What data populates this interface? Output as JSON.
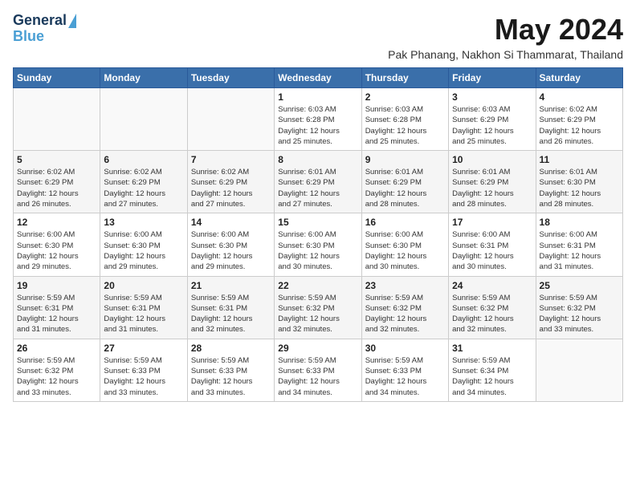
{
  "logo": {
    "line1": "General",
    "line2": "Blue"
  },
  "title": "May 2024",
  "subtitle": "Pak Phanang, Nakhon Si Thammarat, Thailand",
  "days_header": [
    "Sunday",
    "Monday",
    "Tuesday",
    "Wednesday",
    "Thursday",
    "Friday",
    "Saturday"
  ],
  "weeks": [
    [
      {
        "day": "",
        "info": ""
      },
      {
        "day": "",
        "info": ""
      },
      {
        "day": "",
        "info": ""
      },
      {
        "day": "1",
        "info": "Sunrise: 6:03 AM\nSunset: 6:28 PM\nDaylight: 12 hours\nand 25 minutes."
      },
      {
        "day": "2",
        "info": "Sunrise: 6:03 AM\nSunset: 6:28 PM\nDaylight: 12 hours\nand 25 minutes."
      },
      {
        "day": "3",
        "info": "Sunrise: 6:03 AM\nSunset: 6:29 PM\nDaylight: 12 hours\nand 25 minutes."
      },
      {
        "day": "4",
        "info": "Sunrise: 6:02 AM\nSunset: 6:29 PM\nDaylight: 12 hours\nand 26 minutes."
      }
    ],
    [
      {
        "day": "5",
        "info": "Sunrise: 6:02 AM\nSunset: 6:29 PM\nDaylight: 12 hours\nand 26 minutes."
      },
      {
        "day": "6",
        "info": "Sunrise: 6:02 AM\nSunset: 6:29 PM\nDaylight: 12 hours\nand 27 minutes."
      },
      {
        "day": "7",
        "info": "Sunrise: 6:02 AM\nSunset: 6:29 PM\nDaylight: 12 hours\nand 27 minutes."
      },
      {
        "day": "8",
        "info": "Sunrise: 6:01 AM\nSunset: 6:29 PM\nDaylight: 12 hours\nand 27 minutes."
      },
      {
        "day": "9",
        "info": "Sunrise: 6:01 AM\nSunset: 6:29 PM\nDaylight: 12 hours\nand 28 minutes."
      },
      {
        "day": "10",
        "info": "Sunrise: 6:01 AM\nSunset: 6:29 PM\nDaylight: 12 hours\nand 28 minutes."
      },
      {
        "day": "11",
        "info": "Sunrise: 6:01 AM\nSunset: 6:30 PM\nDaylight: 12 hours\nand 28 minutes."
      }
    ],
    [
      {
        "day": "12",
        "info": "Sunrise: 6:00 AM\nSunset: 6:30 PM\nDaylight: 12 hours\nand 29 minutes."
      },
      {
        "day": "13",
        "info": "Sunrise: 6:00 AM\nSunset: 6:30 PM\nDaylight: 12 hours\nand 29 minutes."
      },
      {
        "day": "14",
        "info": "Sunrise: 6:00 AM\nSunset: 6:30 PM\nDaylight: 12 hours\nand 29 minutes."
      },
      {
        "day": "15",
        "info": "Sunrise: 6:00 AM\nSunset: 6:30 PM\nDaylight: 12 hours\nand 30 minutes."
      },
      {
        "day": "16",
        "info": "Sunrise: 6:00 AM\nSunset: 6:30 PM\nDaylight: 12 hours\nand 30 minutes."
      },
      {
        "day": "17",
        "info": "Sunrise: 6:00 AM\nSunset: 6:31 PM\nDaylight: 12 hours\nand 30 minutes."
      },
      {
        "day": "18",
        "info": "Sunrise: 6:00 AM\nSunset: 6:31 PM\nDaylight: 12 hours\nand 31 minutes."
      }
    ],
    [
      {
        "day": "19",
        "info": "Sunrise: 5:59 AM\nSunset: 6:31 PM\nDaylight: 12 hours\nand 31 minutes."
      },
      {
        "day": "20",
        "info": "Sunrise: 5:59 AM\nSunset: 6:31 PM\nDaylight: 12 hours\nand 31 minutes."
      },
      {
        "day": "21",
        "info": "Sunrise: 5:59 AM\nSunset: 6:31 PM\nDaylight: 12 hours\nand 32 minutes."
      },
      {
        "day": "22",
        "info": "Sunrise: 5:59 AM\nSunset: 6:32 PM\nDaylight: 12 hours\nand 32 minutes."
      },
      {
        "day": "23",
        "info": "Sunrise: 5:59 AM\nSunset: 6:32 PM\nDaylight: 12 hours\nand 32 minutes."
      },
      {
        "day": "24",
        "info": "Sunrise: 5:59 AM\nSunset: 6:32 PM\nDaylight: 12 hours\nand 32 minutes."
      },
      {
        "day": "25",
        "info": "Sunrise: 5:59 AM\nSunset: 6:32 PM\nDaylight: 12 hours\nand 33 minutes."
      }
    ],
    [
      {
        "day": "26",
        "info": "Sunrise: 5:59 AM\nSunset: 6:32 PM\nDaylight: 12 hours\nand 33 minutes."
      },
      {
        "day": "27",
        "info": "Sunrise: 5:59 AM\nSunset: 6:33 PM\nDaylight: 12 hours\nand 33 minutes."
      },
      {
        "day": "28",
        "info": "Sunrise: 5:59 AM\nSunset: 6:33 PM\nDaylight: 12 hours\nand 33 minutes."
      },
      {
        "day": "29",
        "info": "Sunrise: 5:59 AM\nSunset: 6:33 PM\nDaylight: 12 hours\nand 34 minutes."
      },
      {
        "day": "30",
        "info": "Sunrise: 5:59 AM\nSunset: 6:33 PM\nDaylight: 12 hours\nand 34 minutes."
      },
      {
        "day": "31",
        "info": "Sunrise: 5:59 AM\nSunset: 6:34 PM\nDaylight: 12 hours\nand 34 minutes."
      },
      {
        "day": "",
        "info": ""
      }
    ]
  ]
}
